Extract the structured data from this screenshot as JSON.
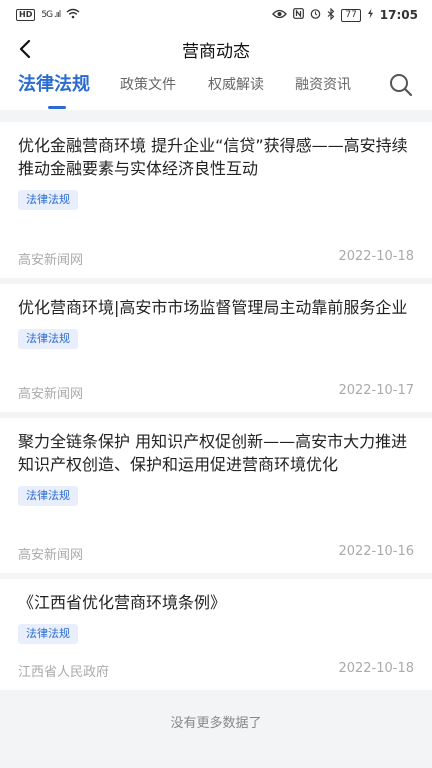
{
  "status_bar": {
    "hd": "HD",
    "signal": "5G .ııl",
    "time": "17:05",
    "battery": "77",
    "icons": [
      "eye-icon",
      "nfc-icon",
      "alarm-icon",
      "bluetooth-icon",
      "battery-icon",
      "charging-icon"
    ]
  },
  "navbar": {
    "title": "营商动态",
    "back_icon": "chevron-left-icon"
  },
  "tabs": [
    {
      "label": "法律法规",
      "active": true
    },
    {
      "label": "政策文件",
      "active": false
    },
    {
      "label": "权威解读",
      "active": false
    },
    {
      "label": "融资资讯",
      "active": false
    }
  ],
  "accent_color": "#2a6bd1",
  "articles": [
    {
      "title": "优化金融营商环境 提升企业“信贷”获得感——高安持续推动金融要素与实体经济良性互动",
      "tag": "法律法规",
      "source": "高安新闻网",
      "date": "2022-10-18"
    },
    {
      "title": "优化营商环境|高安市市场监督管理局主动靠前服务企业",
      "tag": "法律法规",
      "source": "高安新闻网",
      "date": "2022-10-17"
    },
    {
      "title": "聚力全链条保护 用知识产权促创新——高安市大力推进知识产权创造、保护和运用促进营商环境优化",
      "tag": "法律法规",
      "source": "高安新闻网",
      "date": "2022-10-16"
    },
    {
      "title": "《江西省优化营商环境条例》",
      "tag": "法律法规",
      "source": "江西省人民政府",
      "date": "2022-10-18"
    }
  ],
  "footer": {
    "no_more": "没有更多数据了"
  }
}
